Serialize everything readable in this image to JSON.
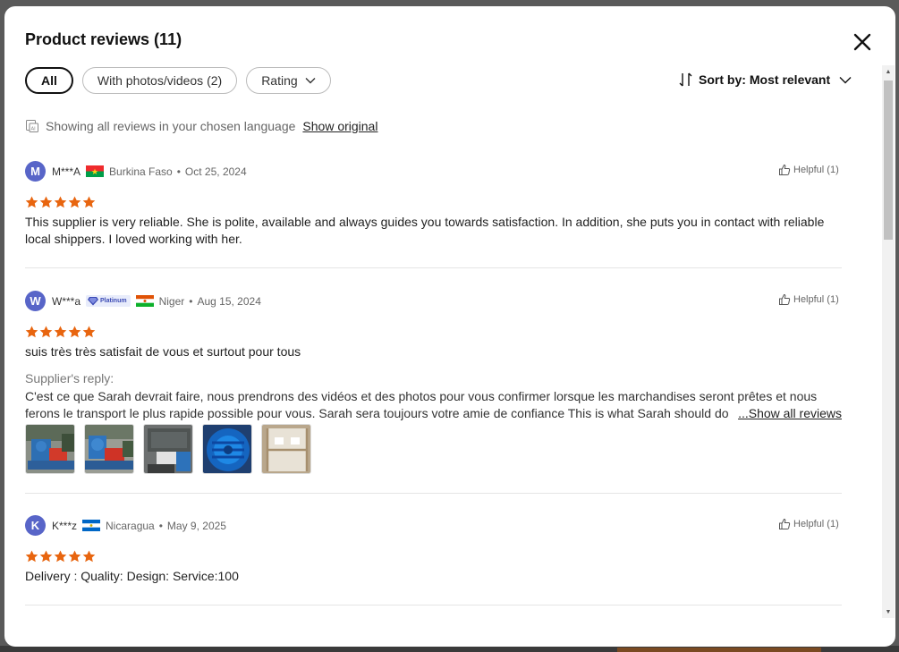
{
  "modal": {
    "title": "Product reviews (11)"
  },
  "filters": {
    "all": "All",
    "with_photos": "With photos/videos (2)",
    "rating": "Rating"
  },
  "sort": {
    "prefix": "Sort by:",
    "value": "Most relevant"
  },
  "language_note": {
    "text": "Showing all reviews in your chosen language",
    "show_original": "Show original"
  },
  "reviews": [
    {
      "initial": "M",
      "user": "M***A",
      "country": "Burkina Faso",
      "date": "Oct 25, 2024",
      "helpful": "Helpful (1)",
      "rating": 5,
      "text": "This supplier is very reliable. She is polite, available and always guides you towards satisfaction. In addition, she puts you in contact with reliable local shippers. I loved working with her."
    },
    {
      "initial": "W",
      "user": "W***a",
      "badge": "Platinum",
      "country": "Niger",
      "date": "Aug 15, 2024",
      "helpful": "Helpful (1)",
      "rating": 5,
      "text": "suis très très satisfait de vous et surtout pour tous",
      "reply_label": "Supplier's reply:",
      "reply_text": "C'est ce que Sarah devrait faire, nous prendrons des vidéos et des photos pour vous confirmer lorsque les marchandises seront prêtes et nous ferons le transport le plus rapide possible pour vous. Sarah sera toujours votre amie de confiance This is what Sarah should do",
      "show_all": "...Show all reviews",
      "photos": [
        "machine-photo",
        "machine-photo",
        "machine-photo",
        "blue-part-photo",
        "crate-photo"
      ]
    },
    {
      "initial": "K",
      "user": "K***z",
      "country": "Nicaragua",
      "date": "May 9, 2025",
      "helpful": "Helpful (1)",
      "rating": 5,
      "text": "Delivery : Quality: Design: Service:100"
    }
  ],
  "colors": {
    "star": "#e8650f",
    "avatar": "#5865c8",
    "platinum": "#3c4bb5"
  }
}
